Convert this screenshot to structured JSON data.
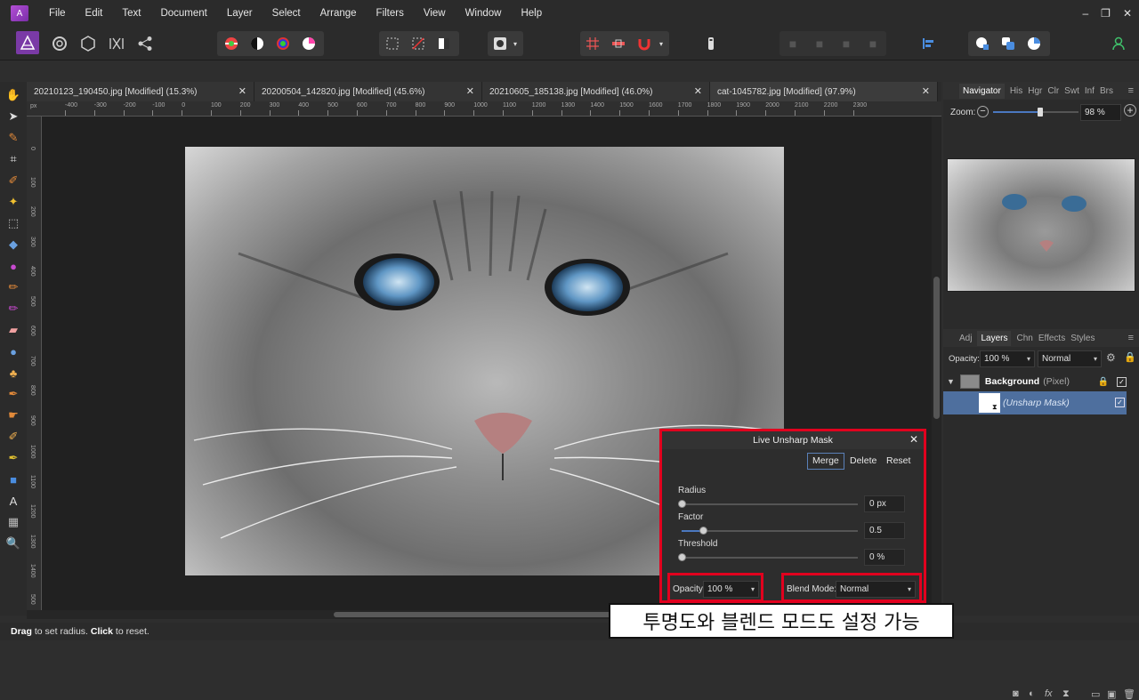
{
  "menubar": {
    "logo": "A",
    "items": [
      "File",
      "Edit",
      "Text",
      "Document",
      "Layer",
      "Select",
      "Arrange",
      "Filters",
      "View",
      "Window",
      "Help"
    ],
    "window_controls": [
      "–",
      "❐",
      "✕"
    ]
  },
  "tabs": [
    {
      "label": "20210123_190450.jpg [Modified] (15.3%)",
      "close": "✕"
    },
    {
      "label": "20200504_142820.jpg [Modified] (45.6%)",
      "close": "✕"
    },
    {
      "label": "20210605_185138.jpg [Modified] (46.0%)",
      "close": "✕"
    },
    {
      "label": "cat-1045782.jpg [Modified] (97.9%)",
      "close": "✕"
    }
  ],
  "ruler": {
    "unit": "px",
    "h_ticks": [
      "-400",
      "-300",
      "-200",
      "-100",
      "0",
      "100",
      "200",
      "300",
      "400",
      "500",
      "600",
      "700",
      "800",
      "900",
      "1000",
      "1100",
      "1200",
      "1300",
      "1400",
      "1500",
      "1600",
      "1700",
      "1800",
      "1900",
      "2000",
      "2100",
      "2200",
      "2300"
    ],
    "v_ticks": [
      "0",
      "100",
      "200",
      "300",
      "400",
      "500",
      "600",
      "700",
      "800",
      "900",
      "1000",
      "1100",
      "1200",
      "1300",
      "1400",
      "500"
    ]
  },
  "navigator": {
    "tabs": [
      "Navigator",
      "His",
      "Hgr",
      "Clr",
      "Swt",
      "Inf",
      "Brs"
    ],
    "zoom_label": "Zoom:",
    "zoom_value": "98 %",
    "zoom_level": 0.55
  },
  "layers_panel": {
    "tabs": [
      "Adj",
      "Layers",
      "Chn",
      "Effects",
      "Styles"
    ],
    "opacity_label": "Opacity:",
    "opacity_value": "100 %",
    "blend_value": "Normal",
    "layer_name": "Background",
    "layer_type": "(Pixel)",
    "mask_name": "(Unsharp Mask)"
  },
  "dialog": {
    "title": "Live Unsharp Mask",
    "buttons": [
      "Merge",
      "Delete",
      "Reset"
    ],
    "sliders": [
      {
        "label": "Radius",
        "value": "0 px",
        "level": 0.0
      },
      {
        "label": "Factor",
        "value": "0.5",
        "level": 0.12
      },
      {
        "label": "Threshold",
        "value": "0 %",
        "level": 0.0
      }
    ],
    "opacity_label": "Opacity:",
    "opacity_value": "100 %",
    "blend_label": "Blend Mode:",
    "blend_value": "Normal"
  },
  "status": {
    "drag": "Drag",
    "drag_text": " to set radius. ",
    "click": "Click",
    "click_text": " to reset."
  },
  "caption": "투명도와 블렌드 모드도 설정 가능",
  "colors": {
    "accent_red": "#e1001e",
    "selection": "#4e6f9e",
    "affinity_purple": "#9b3fc8"
  }
}
